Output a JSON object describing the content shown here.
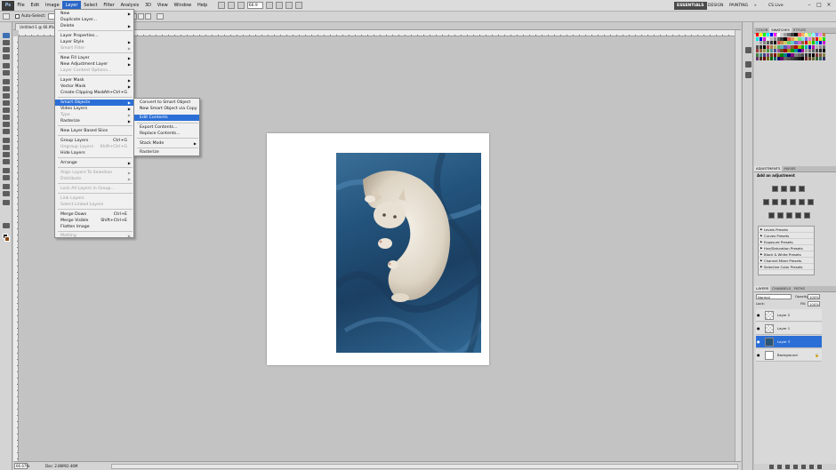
{
  "app": {
    "logo": "Ps",
    "menus": [
      "File",
      "Edit",
      "Image",
      "Layer",
      "Select",
      "Filter",
      "Analysis",
      "3D",
      "View",
      "Window",
      "Help"
    ],
    "active_menu": "Layer",
    "zoom": "66.9",
    "workspaces": [
      "ESSENTIALS",
      "DESIGN",
      "PAINTING"
    ],
    "more_label": "»",
    "cslive": "CS Live",
    "window_controls": [
      "–",
      "□",
      "×"
    ]
  },
  "options": {
    "auto_select": "Auto-Select:"
  },
  "document": {
    "tab": "Untitled-1 @ 66.9% (Layer 3, RGB/8) *",
    "zoom_status": "66.67%",
    "doc_status": "Doc: 2.86M/2.46M"
  },
  "layer_menu": {
    "items": [
      {
        "label": "New",
        "arrow": true
      },
      {
        "label": "Duplicate Layer..."
      },
      {
        "label": "Delete",
        "arrow": true
      },
      {
        "label": "Layer Properties..."
      },
      {
        "label": "Layer Style",
        "arrow": true
      },
      {
        "label": "Smart Filter",
        "arrow": true,
        "disabled": true
      },
      {
        "label": "New Fill Layer",
        "arrow": true
      },
      {
        "label": "New Adjustment Layer",
        "arrow": true
      },
      {
        "label": "Layer Content Options...",
        "disabled": true
      },
      {
        "label": "Layer Mask",
        "arrow": true
      },
      {
        "label": "Vector Mask",
        "arrow": true
      },
      {
        "label": "Create Clipping Mask",
        "shortcut": "Alt+Ctrl+G"
      },
      {
        "label": "Smart Objects",
        "arrow": true,
        "highlight": true
      },
      {
        "label": "Video Layers",
        "arrow": true
      },
      {
        "label": "Type",
        "arrow": true,
        "disabled": true
      },
      {
        "label": "Rasterize",
        "arrow": true
      },
      {
        "label": "New Layer Based Slice"
      },
      {
        "label": "Group Layers",
        "shortcut": "Ctrl+G"
      },
      {
        "label": "Ungroup Layers",
        "shortcut": "Shift+Ctrl+G",
        "disabled": true
      },
      {
        "label": "Hide Layers"
      },
      {
        "label": "Arrange",
        "arrow": true
      },
      {
        "label": "Align Layers To Selection",
        "arrow": true,
        "disabled": true
      },
      {
        "label": "Distribute",
        "arrow": true,
        "disabled": true
      },
      {
        "label": "Lock All Layers in Group...",
        "disabled": true
      },
      {
        "label": "Link Layers",
        "disabled": true
      },
      {
        "label": "Select Linked Layers",
        "disabled": true
      },
      {
        "label": "Merge Down",
        "shortcut": "Ctrl+E"
      },
      {
        "label": "Merge Visible",
        "shortcut": "Shift+Ctrl+E"
      },
      {
        "label": "Flatten Image"
      },
      {
        "label": "Matting",
        "arrow": true,
        "disabled": true
      }
    ]
  },
  "smart_objects_menu": {
    "items": [
      {
        "label": "Convert to Smart Object"
      },
      {
        "label": "New Smart Object via Copy"
      },
      {
        "label": "Edit Contents",
        "highlight": true
      },
      {
        "label": "Export Contents..."
      },
      {
        "label": "Replace Contents..."
      },
      {
        "label": "Stack Mode",
        "arrow": true
      },
      {
        "label": "Rasterize"
      }
    ]
  },
  "panels": {
    "color_tabs": [
      "COLOR",
      "SWATCHES",
      "STYLES"
    ],
    "adjust_tabs": [
      "ADJUSTMENTS",
      "MASKS"
    ],
    "adjust_title": "Add an adjustment",
    "presets": [
      "Levels Presets",
      "Curves Presets",
      "Exposure Presets",
      "Hue/Saturation Presets",
      "Black & White Presets",
      "Channel Mixer Presets",
      "Selective Color Presets"
    ],
    "layers_tabs": [
      "LAYERS",
      "CHANNELS",
      "PATHS"
    ],
    "blend_mode": "Normal",
    "opacity_label": "Opacity:",
    "opacity": "100%",
    "lock_label": "Lock:",
    "fill_label": "Fill:",
    "fill": "100%",
    "layers": [
      {
        "name": "Layer 2",
        "thumb": "transparent"
      },
      {
        "name": "Layer 1",
        "thumb": "transparent"
      },
      {
        "name": "Layer 3",
        "thumb": "photo",
        "selected": true
      },
      {
        "name": "Background",
        "thumb": "white",
        "locked": true
      }
    ]
  },
  "colors": {
    "menu_highlight": "#2b6fd6",
    "active_menu_bg": "#2a66c8",
    "canvas_bg": "#c3c3c3"
  }
}
